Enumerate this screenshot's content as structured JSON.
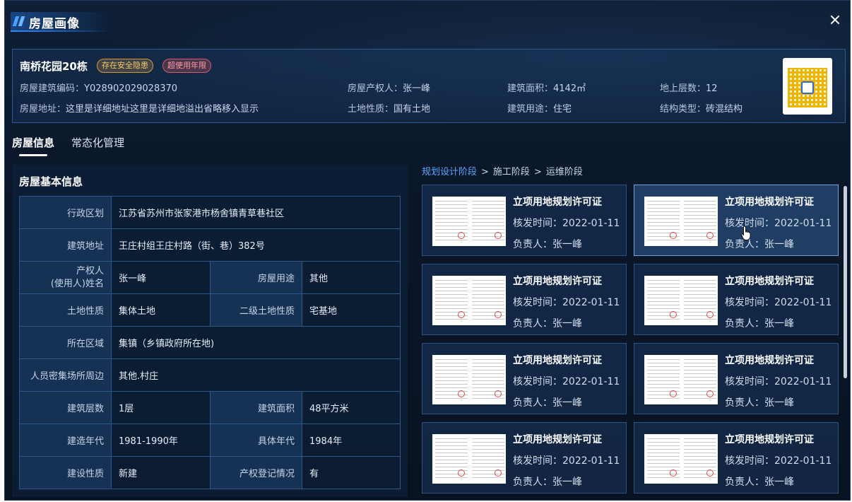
{
  "dialog": {
    "title": "房屋画像"
  },
  "summary": {
    "name": "南桥花园20栋",
    "tags": [
      "存在安全隐患",
      "超使用年限"
    ],
    "fields": [
      {
        "label": "房屋建筑编码：",
        "value": "Y028902029028370"
      },
      {
        "label": "房屋产权人：",
        "value": "张一峰"
      },
      {
        "label": "建筑面积：",
        "value": "4142㎡"
      },
      {
        "label": "地上层数：",
        "value": "12"
      },
      {
        "label": "房屋地址：",
        "value": "这里是详细地址这里是详细地溢出省略移入显示"
      },
      {
        "label": "土地性质：",
        "value": "国有土地"
      },
      {
        "label": "建筑用途：",
        "value": "住宅"
      },
      {
        "label": "结构类型：",
        "value": "砖混结构"
      }
    ]
  },
  "tabs": [
    {
      "label": "房屋信息",
      "active": true
    },
    {
      "label": "常态化管理",
      "active": false
    }
  ],
  "basic_info": {
    "title": "房屋基本信息",
    "rows": [
      {
        "k1": "行政区划",
        "v1": "江苏省苏州市张家港市杨舍镇青草巷社区"
      },
      {
        "k1": "建筑地址",
        "v1": "王庄村组王庄村路（街、巷）382号"
      },
      {
        "k1": "产权人(使用人)姓名",
        "k1_line1": "产权人",
        "k1_line2": "(使用人)姓名",
        "v1": "张一峰",
        "k2": "房屋用途",
        "v2": "其他"
      },
      {
        "k1": "土地性质",
        "v1": "集体土地",
        "k2": "二级土地性质",
        "v2": "宅基地"
      },
      {
        "k1": "所在区域",
        "v1": "集镇（乡镇政府所在地)"
      },
      {
        "k1": "人员密集场所周边",
        "v1": "其他.村庄"
      },
      {
        "k1": "建筑层数",
        "v1": "1层",
        "k2": "建筑面积",
        "v2": "48平方米"
      },
      {
        "k1": "建造年代",
        "v1": "1981-1990年",
        "k2": "具体年代",
        "v2": "1984年"
      },
      {
        "k1": "建设性质",
        "v1": "新建",
        "k2": "产权登记情况",
        "v2": "有"
      }
    ]
  },
  "breadcrumb": {
    "items": [
      "规划设计阶段",
      "施工阶段",
      "运维阶段"
    ],
    "separator": ">"
  },
  "cards": [
    {
      "title": "立项用地规划许可证",
      "time_label": "核发时间：",
      "time": "2022-01-11",
      "person_label": "负责人：",
      "person": "张一峰"
    },
    {
      "title": "立项用地规划许可证",
      "time_label": "核发时间：",
      "time": "2022-01-11",
      "person_label": "负责人：",
      "person": "张一峰"
    },
    {
      "title": "立项用地规划许可证",
      "time_label": "核发时间：",
      "time": "2022-01-11",
      "person_label": "负责人：",
      "person": "张一峰"
    },
    {
      "title": "立项用地规划许可证",
      "time_label": "核发时间：",
      "time": "2022-01-11",
      "person_label": "负责人：",
      "person": "张一峰"
    },
    {
      "title": "立项用地规划许可证",
      "time_label": "核发时间：",
      "time": "2022-01-11",
      "person_label": "负责人：",
      "person": "张一峰"
    },
    {
      "title": "立项用地规划许可证",
      "time_label": "核发时间：",
      "time": "2022-01-11",
      "person_label": "负责人：",
      "person": "张一峰"
    },
    {
      "title": "立项用地规划许可证",
      "time_label": "核发时间：",
      "time": "2022-01-11",
      "person_label": "负责人：",
      "person": "张一峰"
    },
    {
      "title": "立项用地规划许可证",
      "time_label": "核发时间：",
      "time": "2022-01-11",
      "person_label": "负责人：",
      "person": "张一峰"
    }
  ],
  "colors": {
    "accent": "#5aa6ff",
    "warn_tag": "#f7c771",
    "over_tag": "#ff9ca0",
    "panel_border": "#2d5788"
  }
}
